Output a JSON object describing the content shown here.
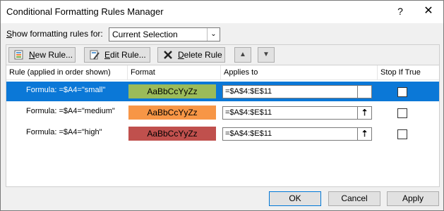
{
  "window": {
    "title": "Conditional Formatting Rules Manager",
    "help": "?",
    "close": "✕"
  },
  "show_for": {
    "label_underlined": "S",
    "label_rest": "how formatting rules for:",
    "selected": "Current Selection"
  },
  "toolbar": {
    "new_rule": {
      "underlined": "N",
      "rest": "ew Rule..."
    },
    "edit_rule": {
      "underlined": "E",
      "rest": "dit Rule..."
    },
    "delete_rule": {
      "underlined": "D",
      "rest": "elete Rule"
    }
  },
  "columns": {
    "rule": "Rule (applied in order shown)",
    "format": "Format",
    "applies_to": "Applies to",
    "stop_if_true": "Stop If True"
  },
  "rules": [
    {
      "rule": "Formula: =$A4=\"small\"",
      "format_preview": "AaBbCcYyZz",
      "format_color": "#9bbb59",
      "applies_to": "=$A$4:$E$11",
      "stop_if_true": false,
      "selected": true
    },
    {
      "rule": "Formula: =$A4=\"medium\"",
      "format_preview": "AaBbCcYyZz",
      "format_color": "#f79646",
      "applies_to": "=$A$4:$E$11",
      "stop_if_true": false,
      "selected": false
    },
    {
      "rule": "Formula: =$A4=\"high\"",
      "format_preview": "AaBbCcYyZz",
      "format_color": "#c0504d",
      "applies_to": "=$A$4:$E$11",
      "stop_if_true": false,
      "selected": false
    }
  ],
  "buttons": {
    "ok": "OK",
    "cancel": "Cancel",
    "apply": "Apply"
  },
  "colors": {
    "selection": "#0b78d7"
  }
}
